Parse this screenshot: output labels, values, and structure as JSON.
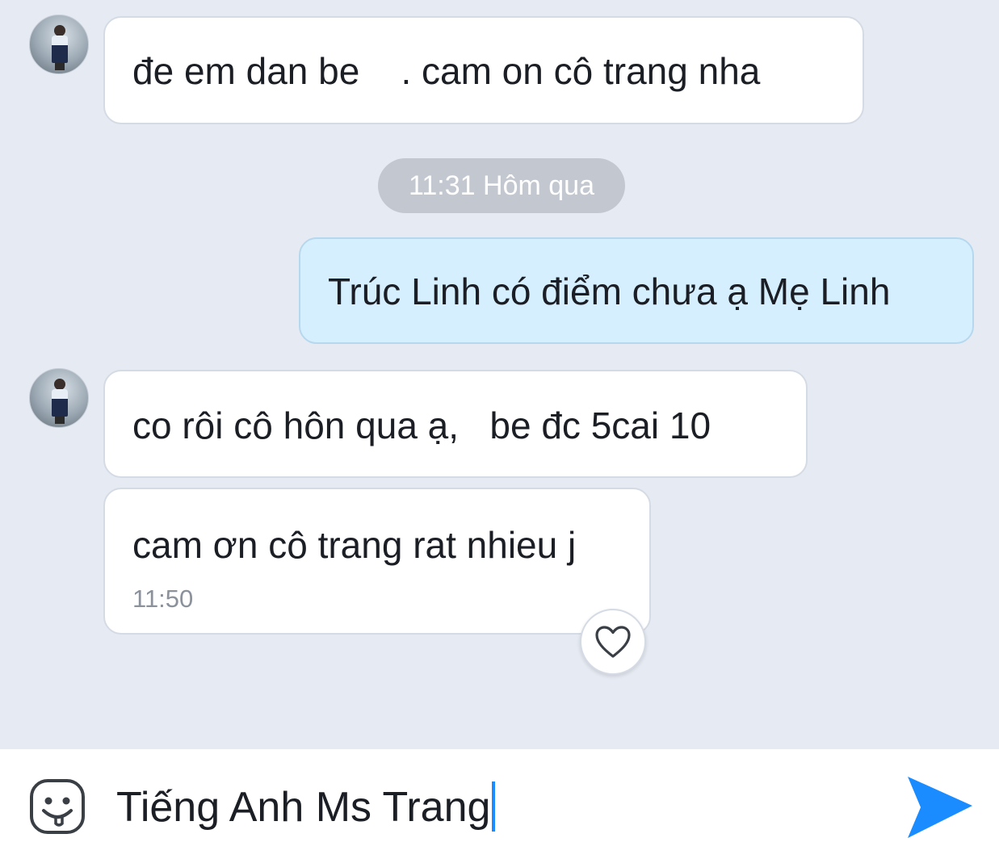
{
  "messages": [
    {
      "text": "đe em dan be    . cam on cô trang nha"
    },
    {
      "text": "Trúc Linh có điểm chưa ạ Mẹ Linh"
    },
    {
      "text": "co rôi cô hôn qua ạ,   be đc 5cai 10"
    },
    {
      "text": "cam ơn cô trang rat nhieu j",
      "time": "11:50"
    }
  ],
  "separator": {
    "label": "11:31 Hôm qua"
  },
  "icons": {
    "avatar": "avatar-photo",
    "react": "heart-icon",
    "emoji": "emoji-icon",
    "send": "send-arrow-icon"
  },
  "composer": {
    "value": "Tiếng Anh Ms Trang"
  },
  "colors": {
    "background": "#e6eaf2",
    "incoming_bubble": "#ffffff",
    "outgoing_bubble": "#d6efff",
    "accent": "#1a8cff"
  }
}
